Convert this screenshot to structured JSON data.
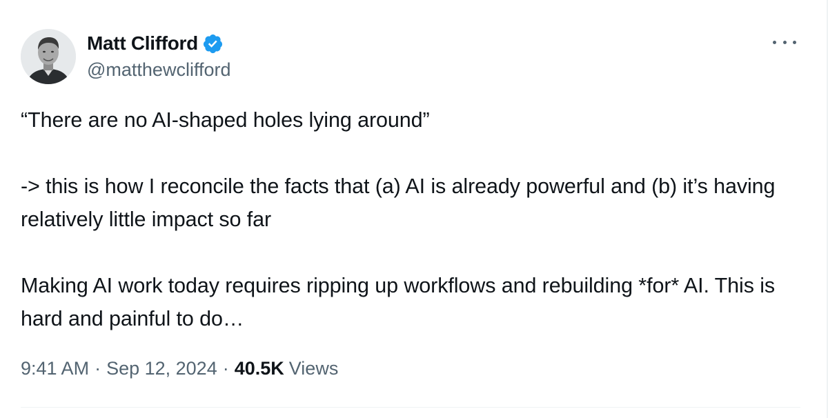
{
  "author": {
    "display_name": "Matt Clifford",
    "handle": "@matthewclifford",
    "verified": true,
    "verified_color": "#1d9bf0"
  },
  "tweet": {
    "paragraphs": [
      "“There are no AI-shaped holes lying around”",
      "-> this is how I reconcile the facts that (a) AI is already powerful and (b) it’s having relatively little impact so far",
      "Making AI work today requires ripping up workflows and rebuilding *for* AI. This is hard and painful to do…"
    ]
  },
  "meta": {
    "time": "9:41 AM",
    "separator": "·",
    "date": "Sep 12, 2024",
    "views_count": "40.5K",
    "views_label": "Views"
  },
  "icons": {
    "more": "more-options-icon",
    "verified": "verified-badge-icon"
  },
  "colors": {
    "text_primary": "#0f1419",
    "text_secondary": "#536471",
    "divider": "#eff3f4"
  }
}
